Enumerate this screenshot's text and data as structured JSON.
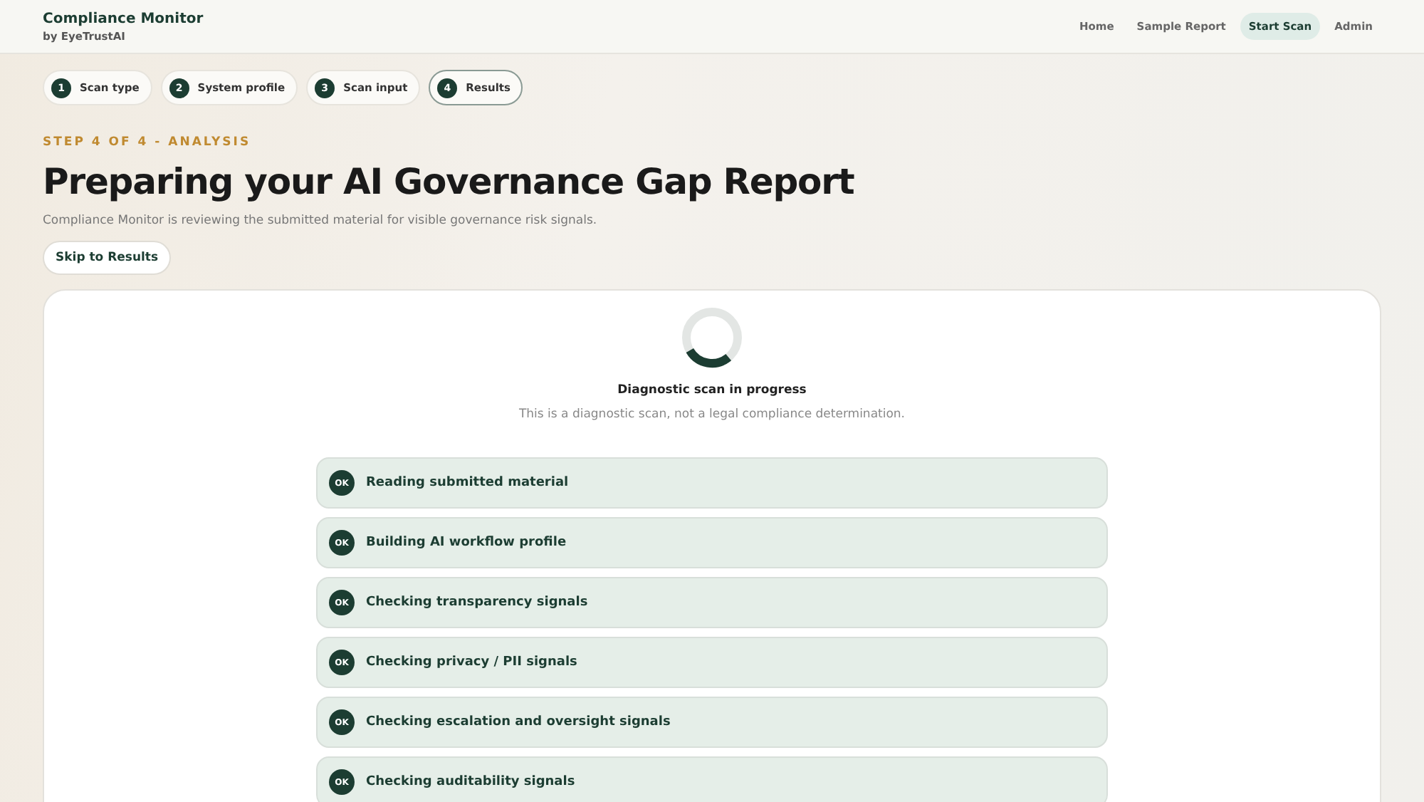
{
  "header": {
    "brand": "Compliance Monitor",
    "byline": "by EyeTrustAI",
    "nav": [
      {
        "label": "Home",
        "selected": false
      },
      {
        "label": "Sample Report",
        "selected": false
      },
      {
        "label": "Start Scan",
        "selected": true
      },
      {
        "label": "Admin",
        "selected": false
      }
    ]
  },
  "steps": [
    {
      "number": "1",
      "label": "Scan type",
      "selected": false
    },
    {
      "number": "2",
      "label": "System profile",
      "selected": false
    },
    {
      "number": "3",
      "label": "Scan input",
      "selected": false
    },
    {
      "number": "4",
      "label": "Results",
      "selected": true
    }
  ],
  "eyebrow": "STEP 4 OF 4 - ANALYSIS",
  "title": "Preparing your AI Governance Gap Report",
  "subtitle": "Compliance Monitor is reviewing the submitted material for visible governance risk signals.",
  "skip_button": "Skip to Results",
  "scan": {
    "status": "Diagnostic scan in progress",
    "note": "This is a diagnostic scan, not a legal compliance determination.",
    "checks": [
      {
        "badge": "OK",
        "label": "Reading submitted material",
        "done": true
      },
      {
        "badge": "OK",
        "label": "Building AI workflow profile",
        "done": true
      },
      {
        "badge": "OK",
        "label": "Checking transparency signals",
        "done": true
      },
      {
        "badge": "OK",
        "label": "Checking privacy / PII signals",
        "done": true
      },
      {
        "badge": "OK",
        "label": "Checking escalation and oversight signals",
        "done": true
      },
      {
        "badge": "OK",
        "label": "Checking auditability signals",
        "done": true
      }
    ]
  }
}
